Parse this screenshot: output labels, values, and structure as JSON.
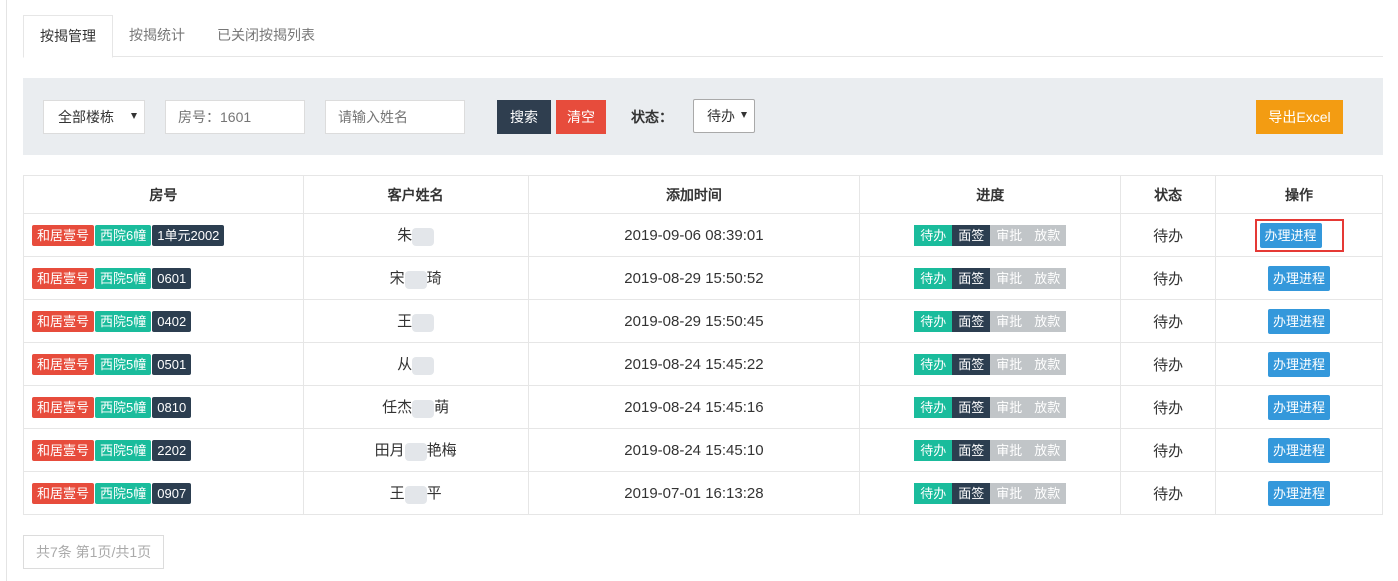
{
  "tabs": [
    {
      "label": "按揭管理",
      "active": true
    },
    {
      "label": "按揭统计",
      "active": false
    },
    {
      "label": "已关闭按揭列表",
      "active": false
    }
  ],
  "filters": {
    "building_select": "全部楼栋",
    "room_placeholder": "房号：1601",
    "name_placeholder": "请输入姓名",
    "search_label": "搜索",
    "clear_label": "清空",
    "status_label": "状态：",
    "status_value": "待办",
    "export_label": "导出Excel"
  },
  "table": {
    "headers": [
      "房号",
      "客户姓名",
      "添加时间",
      "进度",
      "状态",
      "操作"
    ],
    "progress_steps": [
      "待办",
      "面签",
      "审批",
      "放款"
    ],
    "action_label": "办理进程",
    "rows": [
      {
        "tags": [
          "和居壹号",
          "西院6幢",
          "1单元2002"
        ],
        "name_pre": "朱",
        "name_post": "",
        "time": "2019-09-06 08:39:01",
        "status": "待办"
      },
      {
        "tags": [
          "和居壹号",
          "西院5幢",
          "0601"
        ],
        "name_pre": "宋",
        "name_post": "琦",
        "time": "2019-08-29 15:50:52",
        "status": "待办"
      },
      {
        "tags": [
          "和居壹号",
          "西院5幢",
          "0402"
        ],
        "name_pre": "王",
        "name_post": "",
        "time": "2019-08-29 15:50:45",
        "status": "待办"
      },
      {
        "tags": [
          "和居壹号",
          "西院5幢",
          "0501"
        ],
        "name_pre": "从",
        "name_post": "",
        "time": "2019-08-24 15:45:22",
        "status": "待办"
      },
      {
        "tags": [
          "和居壹号",
          "西院5幢",
          "0810"
        ],
        "name_pre": "任杰",
        "name_post": "萌",
        "time": "2019-08-24 15:45:16",
        "status": "待办"
      },
      {
        "tags": [
          "和居壹号",
          "西院5幢",
          "2202"
        ],
        "name_pre": "田月",
        "name_post": "艳梅",
        "time": "2019-08-24 15:45:10",
        "status": "待办"
      },
      {
        "tags": [
          "和居壹号",
          "西院5幢",
          "0907"
        ],
        "name_pre": "王",
        "name_post": "平",
        "time": "2019-07-01 16:13:28",
        "status": "待办"
      }
    ]
  },
  "pagination": {
    "text": "共7条  第1页/共1页"
  },
  "colors": {
    "tag_red": "#e74c3c",
    "tag_green": "#1abc9c",
    "tag_dark": "#2c3e50",
    "action_blue": "#3498db",
    "export_orange": "#f39c12",
    "highlight_red": "#e53935"
  }
}
